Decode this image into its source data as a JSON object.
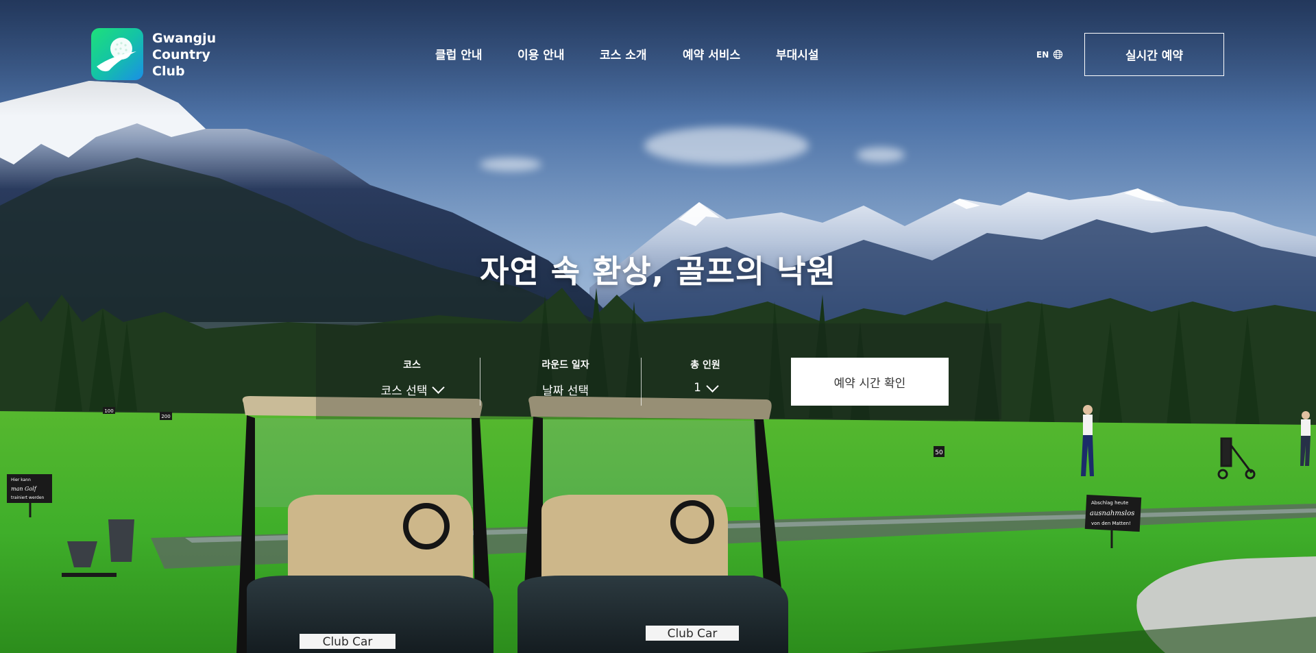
{
  "brand": {
    "line1": "Gwangju",
    "line2": "Country",
    "line3": "Club",
    "logo_icon": "golf-ball-swoosh-icon"
  },
  "nav": {
    "items": [
      {
        "label": "클럽 안내"
      },
      {
        "label": "이용 안내"
      },
      {
        "label": "코스 소개"
      },
      {
        "label": "예약 서비스"
      },
      {
        "label": "부대시설"
      }
    ]
  },
  "header": {
    "language_label": "EN",
    "language_icon": "globe-icon",
    "reserve_label": "실시간 예약"
  },
  "hero": {
    "title": "자연 속 환상, 골프의 낙원"
  },
  "booking": {
    "course": {
      "label": "코스",
      "value": "코스 선택"
    },
    "date": {
      "label": "라운드 일자",
      "value": "날짜 선택"
    },
    "people": {
      "label": "총 인원",
      "value": "1"
    },
    "submit_label": "예약 시간 확인"
  },
  "scene": {
    "cart_label_left": "Club Car",
    "cart_label_right": "Club Car",
    "sign_left": [
      "Hier kann",
      "man Golf",
      "trainiert werden"
    ],
    "sign_right": [
      "Abschlag heute",
      "ausnahmslos",
      "von den Matten!"
    ],
    "distance_marker": "50",
    "distance_marker_left": "200",
    "distance_marker_far_left": "100"
  },
  "colors": {
    "logo_gradient_start": "#1ee07a",
    "logo_gradient_end": "#1a8fe6",
    "button_bg": "#ffffff",
    "grass": "#3fae2a"
  }
}
